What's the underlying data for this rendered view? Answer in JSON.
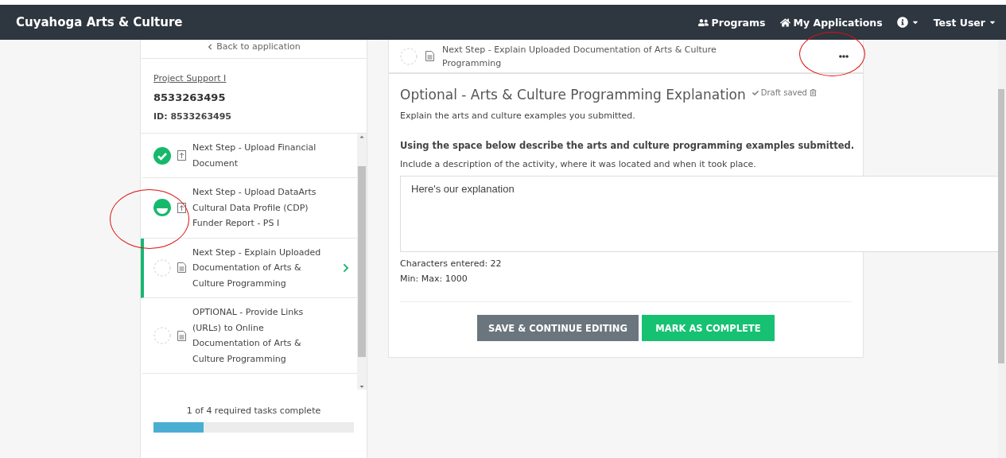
{
  "navbar": {
    "brand": "Cuyahoga Arts & Culture",
    "links": [
      {
        "kind": "programs",
        "label": "Programs"
      },
      {
        "kind": "home",
        "label": "My Applications"
      }
    ],
    "info_menu": {
      "kind": "info"
    },
    "user_menu": {
      "label": "Test User"
    }
  },
  "sidebar": {
    "back_link": "Back to application",
    "project_link": "Project Support I",
    "project_number": "8533263495",
    "project_id": "ID: 8533263495",
    "tasks": [
      {
        "label": "Next Step - Upload Financial Document",
        "done": true,
        "kind": "upload",
        "selected": false
      },
      {
        "label": "Next Step - Upload DataArts Cultural Data Profile (CDP) Funder Report - PS I",
        "done": false,
        "started": true,
        "kind": "upload",
        "selected": false
      },
      {
        "label": "Next Step - Explain Uploaded Documentation of Arts & Culture Programming",
        "done": false,
        "started": false,
        "kind": "document",
        "selected": true
      },
      {
        "label": "OPTIONAL - Provide Links (URLs) to Online Documentation of Arts & Culture Programming",
        "done": false,
        "started": false,
        "kind": "document",
        "selected": false
      }
    ],
    "progress_text": "1 of 4 required tasks complete",
    "progress": {
      "level": 0.25
    }
  },
  "task_header": {
    "title": "Next Step - Explain Uploaded Documentation of Arts & Culture Programming",
    "done": false,
    "started": false,
    "kind": "document"
  },
  "form": {
    "title": "Optional - Arts & Culture Programming Explanation",
    "draft_status": "Draft saved",
    "description": "Explain the arts and culture examples you submitted.",
    "question": "Using the space below describe the arts and culture programming examples submitted.",
    "hint": "Include a description of the activity, where it was located and when it took place.",
    "answer": "Here's our explanation",
    "characters": "Characters entered: 22",
    "limits": "Min: Max: 1000",
    "buttons": [
      {
        "kind": "secondary",
        "label": "SAVE & CONTINUE EDITING"
      },
      {
        "kind": "primary",
        "label": "MARK AS COMPLETE"
      }
    ]
  }
}
